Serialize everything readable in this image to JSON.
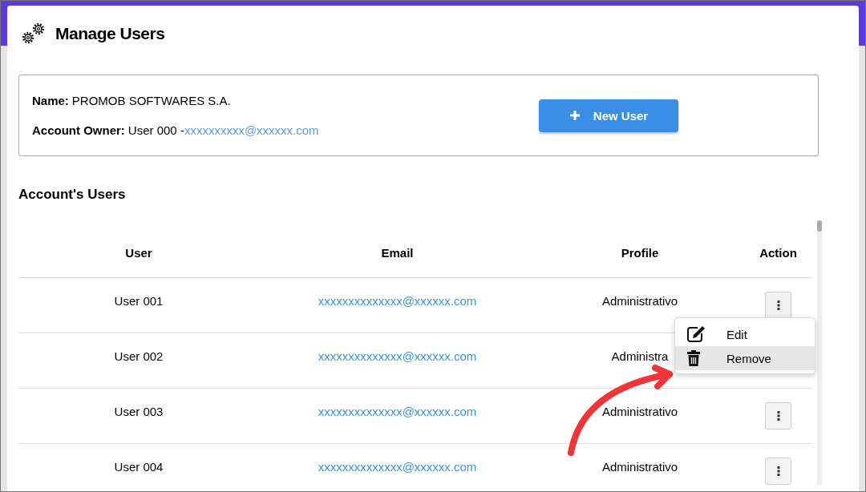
{
  "page": {
    "title": "Manage Users"
  },
  "account": {
    "name_label": "Name:",
    "name": "PROMOB SOFTWARES S.A.",
    "owner_label": "Account Owner:",
    "owner": "User 000 -",
    "owner_email": "xxxxxxxxxx@xxxxxx.com"
  },
  "new_user_button": {
    "label": "New User"
  },
  "section_title": "Account's Users",
  "table": {
    "columns": [
      "User",
      "Email",
      "Profile",
      "Action"
    ],
    "rows": [
      {
        "user": "User 001",
        "email": "xxxxxxxxxxxxxx@xxxxxx.com",
        "profile": "Administrativo",
        "menu_open": true
      },
      {
        "user": "User 002",
        "email": "xxxxxxxxxxxxxx@xxxxxx.com",
        "profile": "Administra",
        "menu_open": false
      },
      {
        "user": "User 003",
        "email": "xxxxxxxxxxxxxx@xxxxxx.com",
        "profile": "Administrativo",
        "menu_open": false
      },
      {
        "user": "User 004",
        "email": "xxxxxxxxxxxxxx@xxxxxx.com",
        "profile": "Administrativo",
        "menu_open": false
      }
    ]
  },
  "context_menu": {
    "items": [
      {
        "kind": "edit",
        "label": "Edit",
        "highlighted": false
      },
      {
        "kind": "remove",
        "label": "Remove",
        "highlighted": true
      }
    ]
  }
}
